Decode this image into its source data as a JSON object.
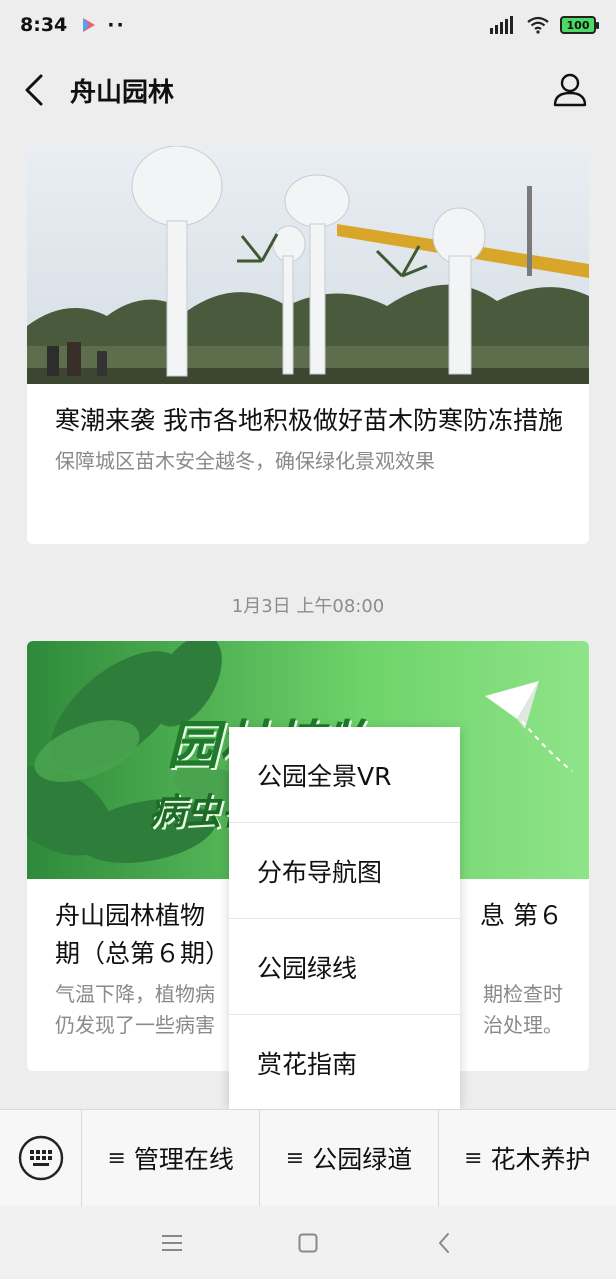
{
  "status_bar": {
    "time": "8:34",
    "dots": "··",
    "battery": "100"
  },
  "nav": {
    "title": "舟山园林"
  },
  "article1": {
    "title": "寒潮来袭 我市各地积极做好苗木防寒防冻措施",
    "desc": "保障城区苗木安全越冬，确保绿化景观效果"
  },
  "timestamp": "1月3日 上午08:00",
  "article2": {
    "title_left": "舟山园林植物",
    "title_right": "息 第６",
    "title_line2": "期（总第６期）",
    "desc_line1_left": "气温下降，植物病",
    "desc_line1_right": "期检查时",
    "desc_line2_left": "仍发现了一些病害",
    "desc_line2_right": "治处理。",
    "banner_line1": "园林植物",
    "banner_line2": "病虫害"
  },
  "popup": {
    "items": [
      "公园全景VR",
      "分布导航图",
      "公园绿线",
      "赏花指南"
    ]
  },
  "menu_bar": {
    "items": [
      "管理在线",
      "公园绿道",
      "花木养护"
    ],
    "lines_glyph": "≡"
  },
  "colors": {
    "background": "#ededed",
    "battery_green": "#4cd964",
    "banner_green": "#43b642"
  },
  "icons": {
    "back": "back-arrow-icon",
    "profile": "user-icon",
    "keyboard": "keyboard-icon",
    "home": "square-home-icon",
    "recent": "menu-lines-icon",
    "sys_back": "chevron-left-icon"
  }
}
